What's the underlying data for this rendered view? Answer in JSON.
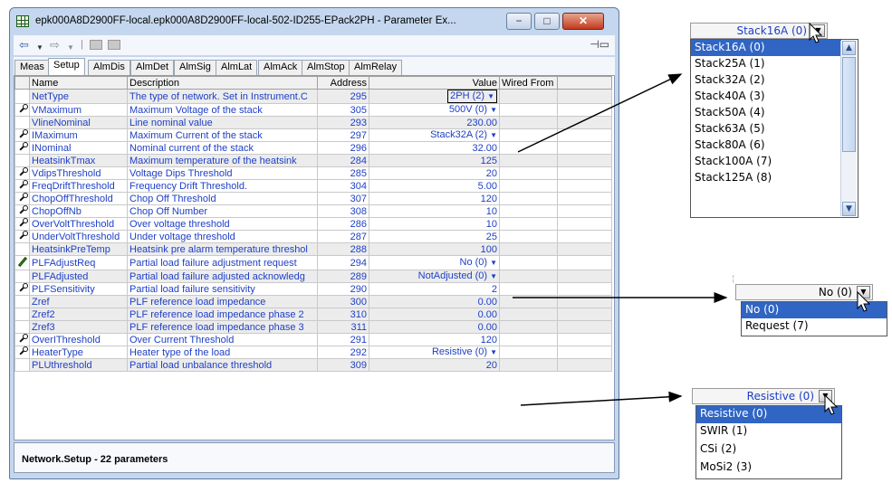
{
  "window": {
    "title": "epk000A8D2900FF-local.epk000A8D2900FF-local-502-ID255-EPack2PH - Parameter Ex..."
  },
  "tabs": [
    "Meas",
    "Setup",
    "AlmDis",
    "AlmDet",
    "AlmSig",
    "AlmLat",
    "AlmAck",
    "AlmStop",
    "AlmRelay"
  ],
  "active_tab": "Setup",
  "columns": [
    "Name",
    "Description",
    "Address",
    "Value",
    "Wired From"
  ],
  "rows": [
    {
      "icon": "",
      "name": "NetType",
      "description": "The type of network. Set in Instrument.C",
      "address": "295",
      "value": "2PH (2)",
      "dropdown": true
    },
    {
      "icon": "wrench-icon",
      "name": "VMaximum",
      "description": "Maximum Voltage of the stack",
      "address": "305",
      "value": "500V (0)",
      "dropdown": true
    },
    {
      "icon": "",
      "name": "VlineNominal",
      "description": "Line nominal value",
      "address": "293",
      "value": "230.00",
      "dropdown": false
    },
    {
      "icon": "wrench-icon",
      "name": "IMaximum",
      "description": "Maximum Current of the stack",
      "address": "297",
      "value": "Stack32A (2)",
      "dropdown": true
    },
    {
      "icon": "wrench-icon",
      "name": "INominal",
      "description": "Nominal current of the stack",
      "address": "296",
      "value": "32.00",
      "dropdown": false
    },
    {
      "icon": "",
      "name": "HeatsinkTmax",
      "description": "Maximum temperature of the heatsink",
      "address": "284",
      "value": "125",
      "dropdown": false
    },
    {
      "icon": "wrench-icon",
      "name": "VdipsThreshold",
      "description": "Voltage Dips Threshold",
      "address": "285",
      "value": "20",
      "dropdown": false
    },
    {
      "icon": "wrench-icon",
      "name": "FreqDriftThreshold",
      "description": "Frequency Drift Threshold.",
      "address": "304",
      "value": "5.00",
      "dropdown": false
    },
    {
      "icon": "wrench-icon",
      "name": "ChopOffThreshold",
      "description": "Chop Off Threshold",
      "address": "307",
      "value": "120",
      "dropdown": false
    },
    {
      "icon": "wrench-icon",
      "name": "ChopOffNb",
      "description": "Chop Off Number",
      "address": "308",
      "value": "10",
      "dropdown": false
    },
    {
      "icon": "wrench-icon",
      "name": "OverVoltThreshold",
      "description": "Over voltage threshold",
      "address": "286",
      "value": "10",
      "dropdown": false
    },
    {
      "icon": "wrench-icon",
      "name": "UnderVoltThreshold",
      "description": "Under voltage threshold",
      "address": "287",
      "value": "25",
      "dropdown": false
    },
    {
      "icon": "",
      "name": "HeatsinkPreTemp",
      "description": "Heatsink pre alarm temperature threshol",
      "address": "288",
      "value": "100",
      "dropdown": false
    },
    {
      "icon": "pencil-icon",
      "name": "PLFAdjustReq",
      "description": "Partial load failure adjustment request",
      "address": "294",
      "value": "No (0)",
      "dropdown": true
    },
    {
      "icon": "",
      "name": "PLFAdjusted",
      "description": "Partial load failure adjusted acknowledg",
      "address": "289",
      "value": "NotAdjusted (0)",
      "dropdown": true
    },
    {
      "icon": "wrench-icon",
      "name": "PLFSensitivity",
      "description": "Partial load failure sensitivity",
      "address": "290",
      "value": "2",
      "dropdown": false
    },
    {
      "icon": "",
      "name": "Zref",
      "description": "PLF reference load impedance",
      "address": "300",
      "value": "0.00",
      "dropdown": false
    },
    {
      "icon": "",
      "name": "Zref2",
      "description": "PLF reference load impedance phase 2",
      "address": "310",
      "value": "0.00",
      "dropdown": false
    },
    {
      "icon": "",
      "name": "Zref3",
      "description": "PLF reference load impedance phase 3",
      "address": "311",
      "value": "0.00",
      "dropdown": false
    },
    {
      "icon": "wrench-icon",
      "name": "OverIThreshold",
      "description": "Over Current Threshold",
      "address": "291",
      "value": "120",
      "dropdown": false
    },
    {
      "icon": "wrench-icon",
      "name": "HeaterType",
      "description": "Heater type of the load",
      "address": "292",
      "value": "Resistive (0)",
      "dropdown": true
    },
    {
      "icon": "",
      "name": "PLUthreshold",
      "description": "Partial load unbalance threshold",
      "address": "309",
      "value": "20",
      "dropdown": false
    }
  ],
  "status": "Network.Setup  -  22 parameters",
  "popups": {
    "imax": {
      "selected": "Stack16A (0)",
      "options": [
        "Stack16A (0)",
        "Stack25A (1)",
        "Stack32A (2)",
        "Stack40A (3)",
        "Stack50A (4)",
        "Stack63A (5)",
        "Stack80A (6)",
        "Stack100A (7)",
        "Stack125A (8)"
      ]
    },
    "plf": {
      "selected": "No (0)",
      "options": [
        "No (0)",
        "Request (7)"
      ]
    },
    "heater": {
      "selected": "Resistive (0)",
      "options": [
        "Resistive (0)",
        "SWIR (1)",
        "CSi (2)",
        "MoSi2 (3)"
      ]
    }
  },
  "colors": {
    "selection": "#3165c4",
    "name_text": "#1e3fc5",
    "close_button": "#c23a1d"
  }
}
